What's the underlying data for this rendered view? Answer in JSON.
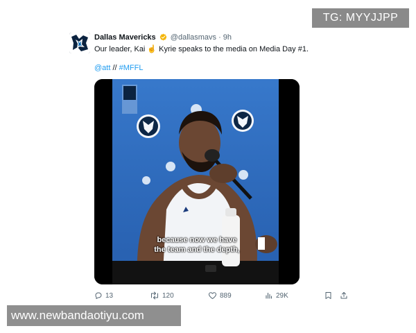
{
  "watermarks": {
    "top_right": "TG: MYYJJPP",
    "bottom_left": "www.newbandaotiyu.com"
  },
  "tweet": {
    "display_name": "Dallas Mavericks",
    "handle": "@dallasmavs",
    "separator": "·",
    "time": "9h",
    "text": "Our leader, Kai ☝️ Kyrie speaks to the media on Media Day #1.",
    "mention": "@att",
    "hashtag_separator": "//",
    "hashtag": "#MFFL",
    "video_subtitle_line1": "because now we have",
    "video_subtitle_line2": "the team and the depth,",
    "icons": {
      "avatar": "mavericks-logo-icon",
      "verified": "verified-badge-icon"
    },
    "colors": {
      "link": "#1d9bf0",
      "verified": "#f4b400",
      "backdrop": "#2f6fc4"
    }
  },
  "actions": {
    "replies": "13",
    "retweets": "120",
    "likes": "889",
    "views": "29K",
    "icons": [
      "reply-icon",
      "retweet-icon",
      "like-icon",
      "views-icon",
      "bookmark-icon",
      "share-icon"
    ]
  }
}
